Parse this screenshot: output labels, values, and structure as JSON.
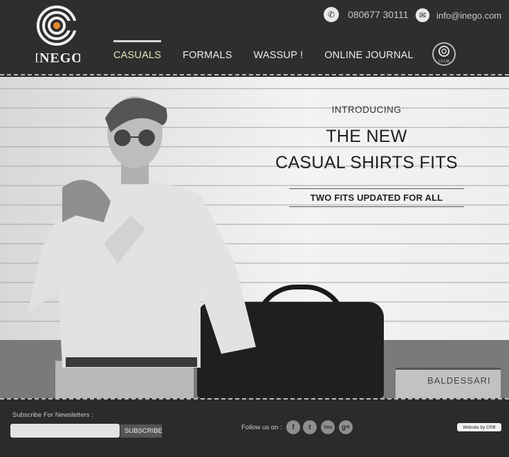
{
  "brand": {
    "name": "INEGO"
  },
  "contact": {
    "phone": "080677 30111",
    "email": "info@inego.com"
  },
  "nav": {
    "items": [
      "CASUALS",
      "FORMALS",
      "WASSUP !",
      "ONLINE JOURNAL"
    ],
    "active": "CASUALS"
  },
  "club": {
    "label": "CLUB"
  },
  "hero": {
    "intro": "INTRODUCING",
    "title_line1": "THE NEW",
    "title_line2": "CASUAL SHIRTS FITS",
    "subtitle": "TWO FITS UPDATED FOR ALL",
    "books_text": "BALDESSARI"
  },
  "footer": {
    "subscribe_label": "Subscribe For Newsletters :",
    "subscribe_placeholder": "",
    "subscribe_button": "SUBSCRIBE",
    "follow_label": "Follow us on :",
    "social": [
      {
        "name": "facebook-icon",
        "glyph": "f"
      },
      {
        "name": "twitter-icon",
        "glyph": "t"
      },
      {
        "name": "youtube-icon",
        "glyph": "You"
      },
      {
        "name": "google-plus-icon",
        "glyph": "g+"
      }
    ],
    "credit": "Website by CRB"
  },
  "colors": {
    "accent_orange": "#e98a2a",
    "active_nav": "#e7e3bb",
    "header_bg": "#2e2e2f"
  }
}
